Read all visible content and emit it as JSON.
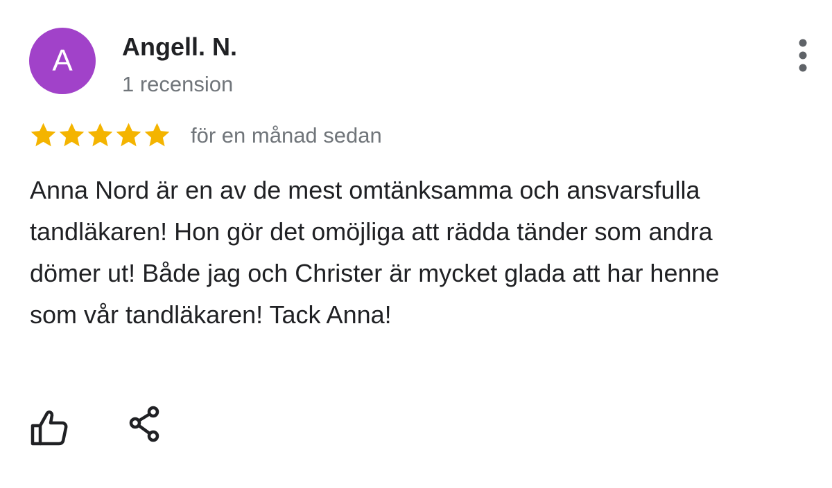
{
  "review": {
    "author": {
      "initial": "A",
      "name": "Angell. N.",
      "review_count": "1 recension",
      "avatar_color": "#a142c9"
    },
    "rating": 5,
    "rating_max": 5,
    "star_color": "#f4b400",
    "time_ago": "för en månad sedan",
    "text": "Anna Nord är en av de mest omtänksamma och ansvarsfulla tandläkaren! Hon gör det omöjliga att rädda tänder som andra dömer ut! Både jag och Christer är mycket glada att har henne som vår tandläkaren! Tack Anna!",
    "icons": {
      "more": "more-vert-icon",
      "like": "thumb-up-icon",
      "share": "share-icon"
    }
  }
}
